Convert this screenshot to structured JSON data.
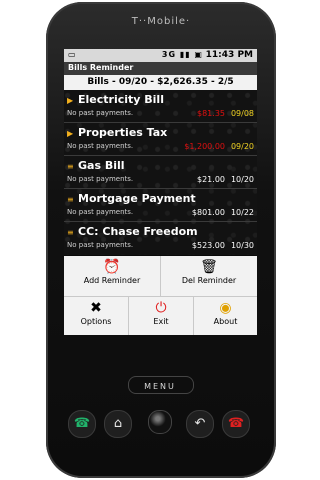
{
  "device": {
    "brand": "T··Mobile·",
    "menu_key": "MENU"
  },
  "statusbar": {
    "left_icon": "sim-icon",
    "icons": "3G ▮▮ ▣",
    "time": "11:43 PM"
  },
  "app": {
    "title": "Bills Reminder",
    "header": "Bills - 09/20 - $2,626.35 - 2/5"
  },
  "bills": [
    {
      "name": "Electricity Bill",
      "note": "No past payments.",
      "amount": "$81.35",
      "date": "09/08",
      "amount_color": "red",
      "date_color": "yellow",
      "marker": "▶"
    },
    {
      "name": "Properties Tax",
      "note": "No past payments.",
      "amount": "$1,200.00",
      "date": "09/20",
      "amount_color": "red",
      "date_color": "yellow",
      "marker": "▶"
    },
    {
      "name": "Gas Bill",
      "note": "No past payments.",
      "amount": "$21.00",
      "date": "10/20",
      "amount_color": "white",
      "date_color": "white",
      "marker": "≡"
    },
    {
      "name": "Mortgage Payment",
      "note": "No past payments.",
      "amount": "$801.00",
      "date": "10/22",
      "amount_color": "white",
      "date_color": "white",
      "marker": "≡"
    },
    {
      "name": "CC: Chase Freedom",
      "note": "No past payments.",
      "amount": "$523.00",
      "date": "10/30",
      "amount_color": "white",
      "date_color": "white",
      "marker": "≡"
    }
  ],
  "menu": {
    "add_reminder": "Add Reminder",
    "del_reminder": "Del Reminder",
    "options": "Options",
    "exit": "Exit",
    "about": "About"
  },
  "icons": {
    "add_reminder": "clock-plus-icon",
    "del_reminder": "trash-can-icon",
    "options": "tools-icon",
    "exit": "power-icon",
    "about": "eye-icon",
    "call": "call-icon",
    "home": "home-icon",
    "back": "back-icon",
    "end_call": "end-call-icon"
  },
  "colors": {
    "red_amount": "#e01010",
    "yellow_date": "#f1d323",
    "white_text": "#ffffff",
    "menu_bg": "#f2f2f2",
    "status_bg": "#d9d9d9",
    "title_bg": "#3a3a3a"
  }
}
